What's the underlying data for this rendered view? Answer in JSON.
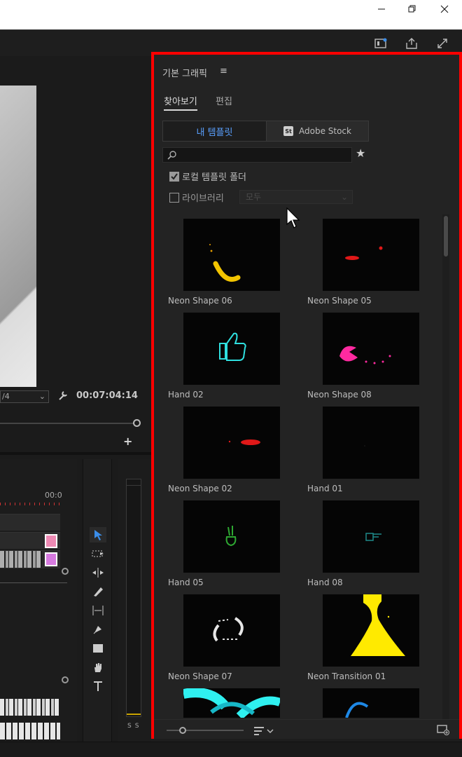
{
  "window": {
    "minimize_icon": "minimize-icon",
    "maximize_icon": "restore-icon",
    "close_icon": "close-icon"
  },
  "monitor": {
    "fit_value": "/4",
    "timecode": "00:07:04:14"
  },
  "timeline": {
    "time_label": "00:0",
    "meter_s1": "S",
    "meter_s2": "S"
  },
  "panel": {
    "title": "기본 그래픽",
    "menu_glyph": "≡",
    "tabs": [
      {
        "label": "찾아보기",
        "active": true
      },
      {
        "label": "편집",
        "active": false
      }
    ],
    "source_buttons": {
      "my_templates": "내 템플릿",
      "stock_badge": "St",
      "adobe_stock": "Adobe Stock"
    },
    "search": {
      "placeholder": "",
      "value": ""
    },
    "local_templates": {
      "label": "로컬 템플릿 폴더",
      "checked": true
    },
    "libraries": {
      "label": "라이브러리",
      "checked": false,
      "dropdown_value": "모두"
    },
    "templates": [
      "Neon Shape 06",
      "Neon Shape 05",
      "Hand 02",
      "Neon Shape 08",
      "Neon Shape 02",
      "Hand 01",
      "Hand 05",
      "Hand 08",
      "Neon Shape 07",
      "Neon Transition 01"
    ]
  },
  "colors": {
    "accent_red": "#ff0000",
    "active_blue": "#5aa0ff",
    "tool_blue": "#3b8eea"
  }
}
